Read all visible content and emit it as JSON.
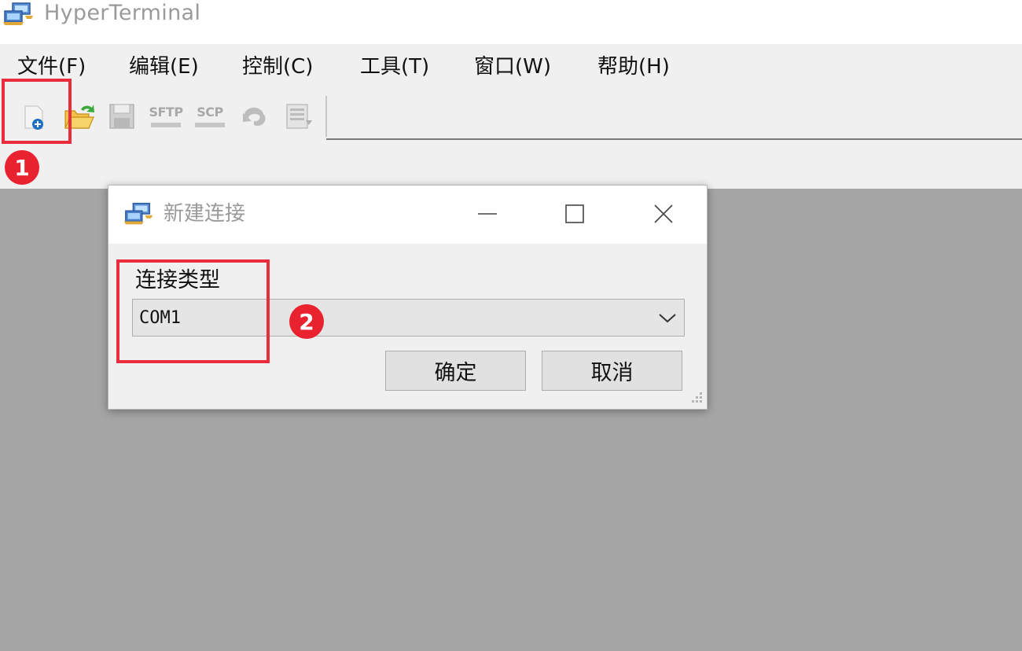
{
  "app": {
    "title": "HyperTerminal",
    "icon": "hyperterminal-app-icon"
  },
  "menu": {
    "items": [
      "文件(F)",
      "编辑(E)",
      "控制(C)",
      "工具(T)",
      "窗口(W)",
      "帮助(H)"
    ]
  },
  "toolbar": {
    "buttons": [
      {
        "icon": "new-connection-icon"
      },
      {
        "icon": "open-folder-icon"
      },
      {
        "icon": "save-icon"
      },
      {
        "icon": "sftp-icon",
        "label": "SFTP"
      },
      {
        "icon": "scp-icon",
        "label": "SCP"
      },
      {
        "icon": "undo-icon"
      },
      {
        "icon": "properties-icon"
      }
    ]
  },
  "annotations": {
    "badge1": "1",
    "badge2": "2",
    "highlight_color": "#ea2c3c"
  },
  "dialog": {
    "title": "新建连接",
    "field_label": "连接类型",
    "selected_value": "COM1",
    "ok_label": "确定",
    "cancel_label": "取消"
  },
  "colors": {
    "workspace": "#a5a5a5",
    "chrome": "#f0f0f0",
    "badge": "#e8232f"
  }
}
